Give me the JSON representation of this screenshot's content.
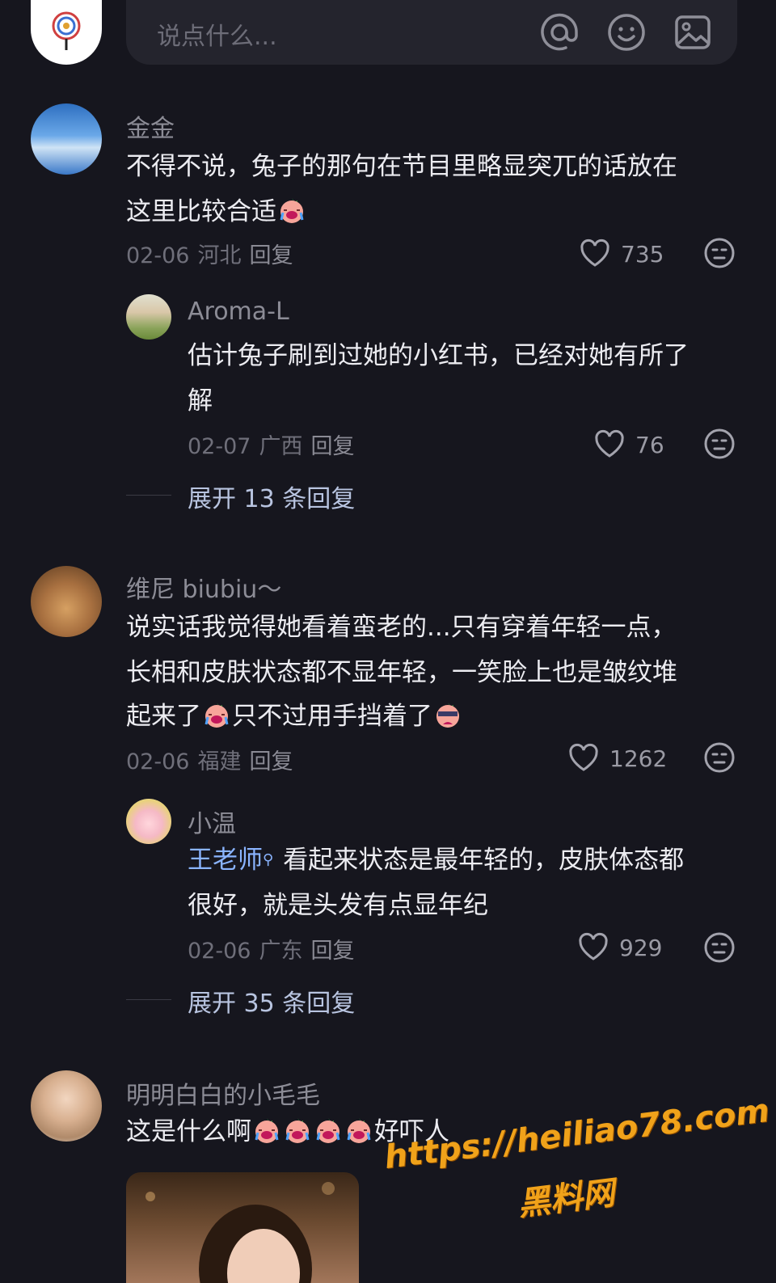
{
  "composer": {
    "placeholder": "说点什么...",
    "mention_icon": "at-icon",
    "emoji_icon": "smiley-icon",
    "image_icon": "image-icon"
  },
  "comments": [
    {
      "name": "金金",
      "lines": [
        "不得不说，兔子的那句在节目里略显突兀的话放在",
        "这里比较合适"
      ],
      "date": "02-06",
      "region": "河北",
      "reply": "回复",
      "likes": "735",
      "replies": [
        {
          "name": "Aroma-L",
          "lines": [
            "估计兔子刷到过她的小红书，已经对她有所了",
            "解"
          ],
          "date": "02-07",
          "region": "广西",
          "reply": "回复",
          "likes": "76"
        }
      ],
      "expand": "展开 13 条回复"
    },
    {
      "name": "维尼 biubiu～",
      "lines": [
        "说实话我觉得她看着蛮老的...只有穿着年轻一点，",
        "长相和皮肤状态都不显年轻，一笑脸上也是皱纹堆",
        "起来了",
        "只不过用手挡着了"
      ],
      "date": "02-06",
      "region": "福建",
      "reply": "回复",
      "likes": "1262",
      "replies": [
        {
          "name": "小温",
          "mention": "王老师",
          "lines": [
            "看起来状态是最年轻的，皮肤体态都",
            "很好，就是头发有点显年纪"
          ],
          "date": "02-06",
          "region": "广东",
          "reply": "回复",
          "likes": "929"
        }
      ],
      "expand": "展开 35 条回复"
    },
    {
      "name": "明明白白的小毛毛",
      "lines": [
        "这是什么啊",
        "好吓人"
      ]
    }
  ],
  "watermark": {
    "url": "https://heiliao78.com",
    "site": "黑料网"
  }
}
